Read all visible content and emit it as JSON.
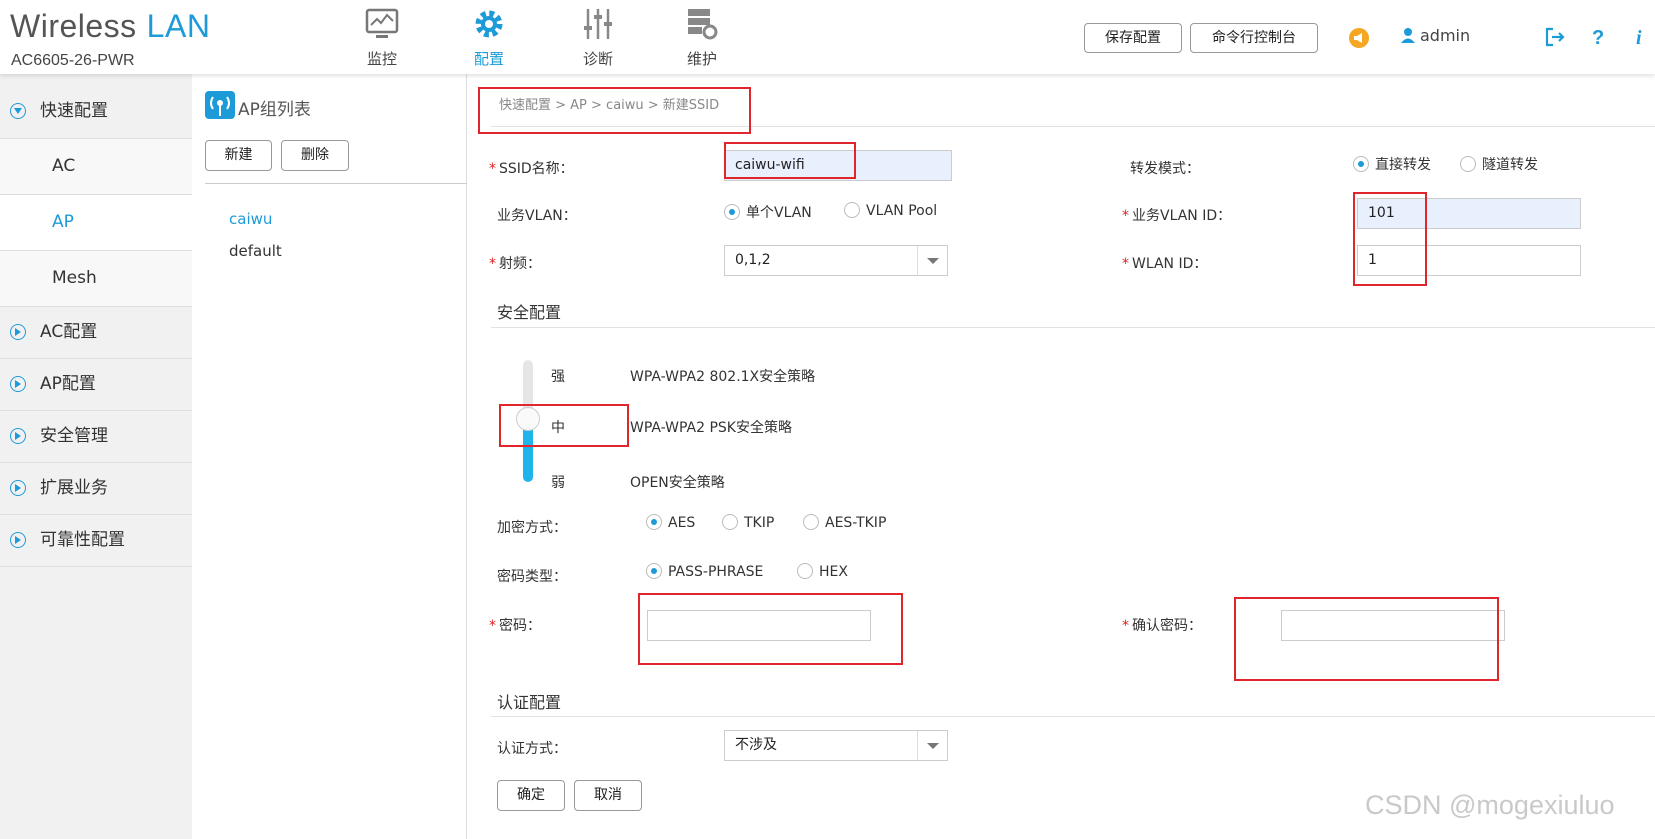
{
  "header": {
    "brand_word1": "Wireless",
    "brand_word2": "LAN",
    "device_model": "AC6605-26-PWR",
    "nav": [
      {
        "label": "监控",
        "icon": "monitor-icon"
      },
      {
        "label": "配置",
        "icon": "gear-icon"
      },
      {
        "label": "诊断",
        "icon": "sliders-icon"
      },
      {
        "label": "维护",
        "icon": "server-gear-icon"
      }
    ],
    "save_config_label": "保存配置",
    "cli_console_label": "命令行控制台",
    "username": "admin"
  },
  "sidebar": {
    "quick_config": "快速配置",
    "sub_items": [
      "AC",
      "AP",
      "Mesh"
    ],
    "sections": [
      "AC配置",
      "AP配置",
      "安全管理",
      "扩展业务",
      "可靠性配置"
    ]
  },
  "ap_group": {
    "title": "AP组列表",
    "new_label": "新建",
    "delete_label": "删除",
    "groups": [
      "caiwu",
      "default"
    ]
  },
  "breadcrumb": "快速配置 > AP > caiwu > 新建SSID",
  "form": {
    "ssid_label": "SSID名称：",
    "ssid_value": "caiwu-wifi",
    "forward_mode_label": "转发模式：",
    "forward_options": [
      "直接转发",
      "隧道转发"
    ],
    "service_vlan_label": "业务VLAN：",
    "vlan_options": [
      "单个VLAN",
      "VLAN Pool"
    ],
    "service_vlan_id_label": "业务VLAN ID：",
    "service_vlan_id_value": "101",
    "radio_label": "射频：",
    "radio_value": "0,1,2",
    "wlan_id_label": "WLAN ID：",
    "wlan_id_value": "1"
  },
  "security": {
    "title": "安全配置",
    "levels": [
      {
        "level": "强",
        "policy": "WPA-WPA2 802.1X安全策略"
      },
      {
        "level": "中",
        "policy": "WPA-WPA2 PSK安全策略"
      },
      {
        "level": "弱",
        "policy": "OPEN安全策略"
      }
    ],
    "selected_level_index": 1,
    "encryption_label": "加密方式：",
    "encryption_options": [
      "AES",
      "TKIP",
      "AES-TKIP"
    ],
    "key_type_label": "密码类型：",
    "key_type_options": [
      "PASS-PHRASE",
      "HEX"
    ],
    "password_label": "密码：",
    "confirm_password_label": "确认密码："
  },
  "auth": {
    "title": "认证配置",
    "method_label": "认证方式：",
    "method_value": "不涉及",
    "ok_label": "确定",
    "cancel_label": "取消"
  },
  "watermark": "CSDN @mogexiuluo",
  "colors": {
    "accent": "#1d9bd8",
    "highlight": "#e0262b",
    "sidebar_bg": "#f1f1f1"
  }
}
